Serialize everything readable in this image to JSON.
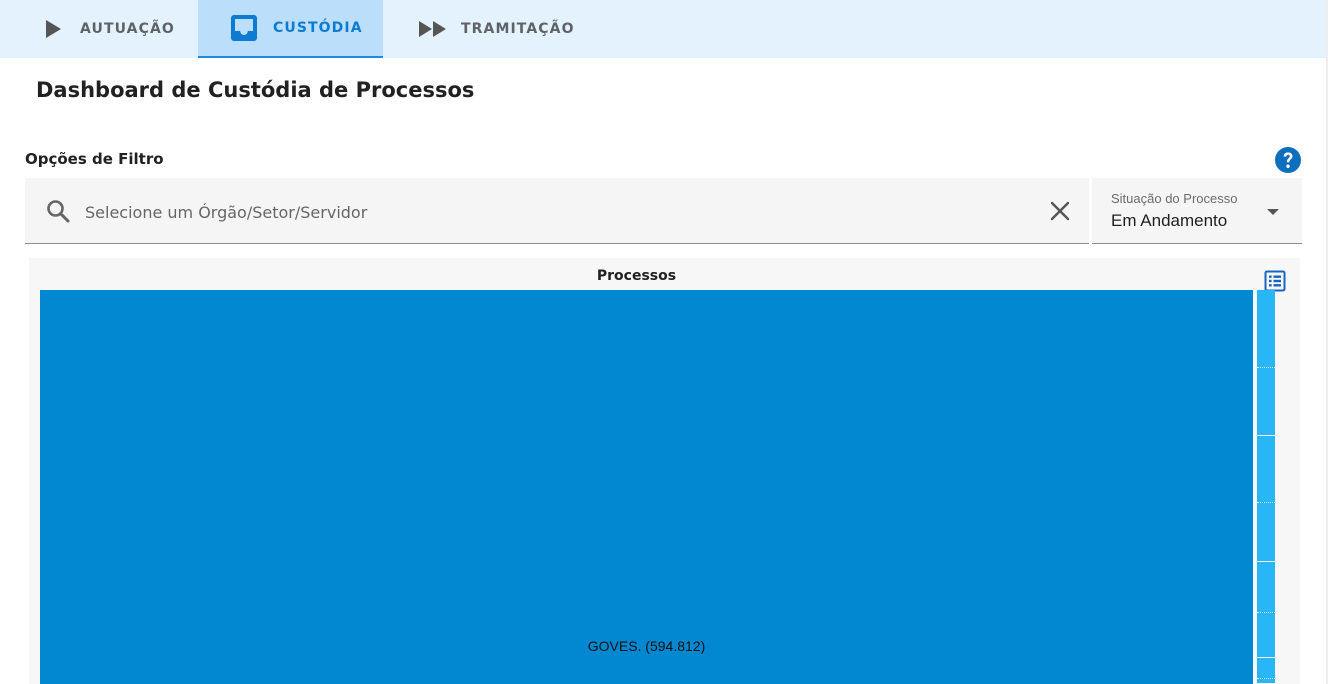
{
  "tabs": [
    {
      "label": "AUTUAÇÃO",
      "icon": "play-icon",
      "active": false
    },
    {
      "label": "CUSTÓDIA",
      "icon": "inbox-icon",
      "active": true
    },
    {
      "label": "TRAMITAÇÃO",
      "icon": "fast-forward-icon",
      "active": false
    }
  ],
  "page": {
    "title": "Dashboard de Custódia de Processos"
  },
  "filters": {
    "title": "Opções de Filtro",
    "search": {
      "placeholder": "Selecione um Órgão/Setor/Servidor",
      "value": ""
    },
    "situacao": {
      "label": "Situação do Processo",
      "value": "Em Andamento"
    }
  },
  "chart_data": {
    "type": "treemap",
    "title": "Processos",
    "tiles": [
      {
        "label": "GOVES. (594.812)",
        "value": 594812
      }
    ]
  },
  "colors": {
    "tab_bar": "#e3f2fd",
    "tab_active": "#bbdefb",
    "accent": "#0d7bd1",
    "treemap_main": "#0288d1",
    "treemap_minor": "#29b6f6"
  }
}
